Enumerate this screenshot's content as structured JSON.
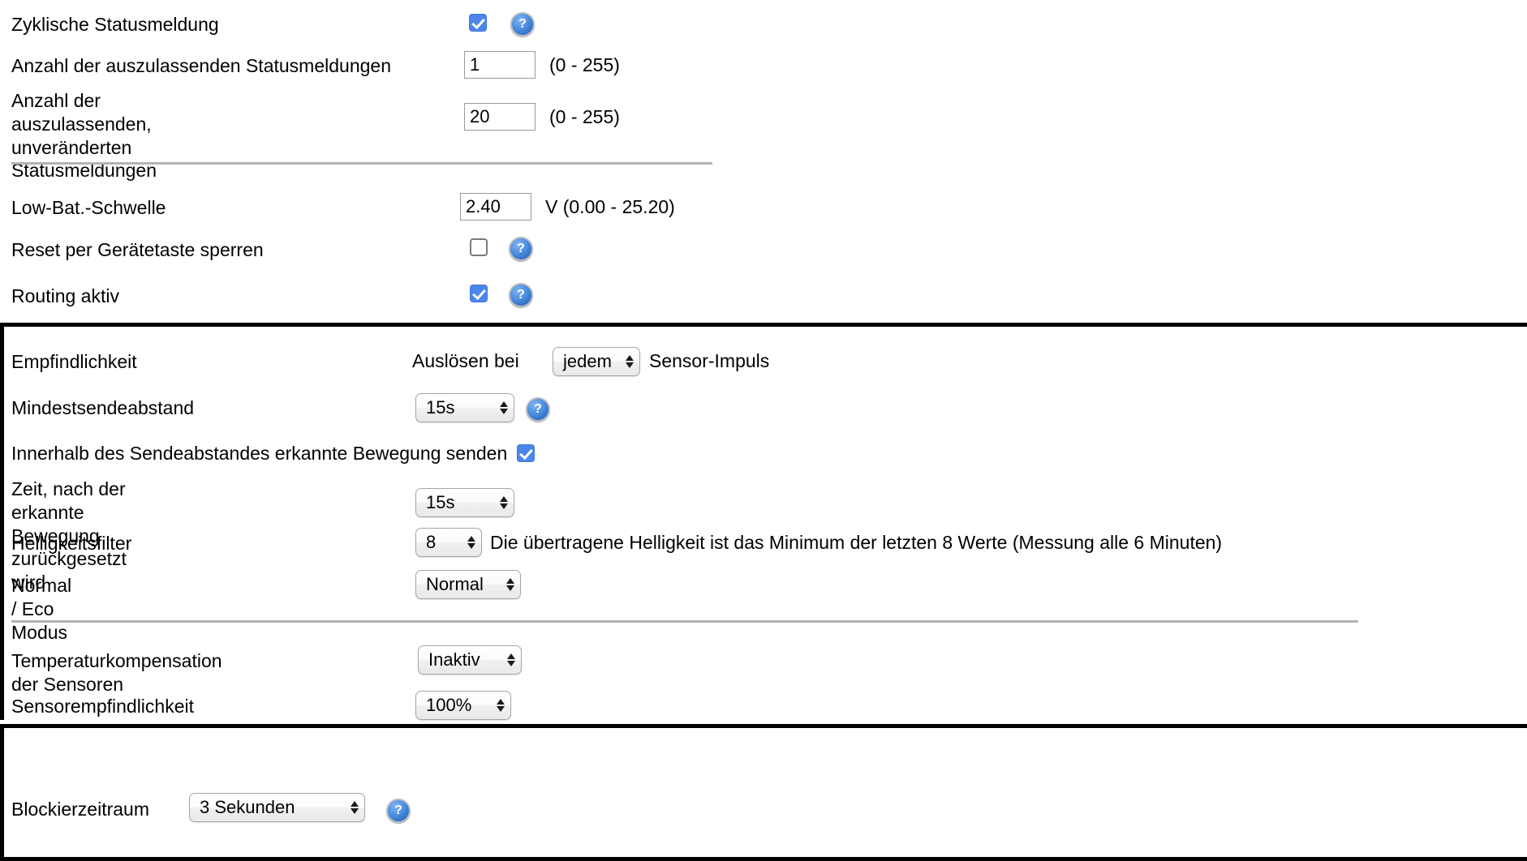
{
  "sections": {
    "status": {
      "cyclic_status": {
        "label": "Zyklische Statusmeldung",
        "checked_value": "on",
        "help": "?"
      },
      "skip_count": {
        "label": "Anzahl der auszulassenden Statusmeldungen",
        "value": "1",
        "range": "(0 - 255)"
      },
      "skip_unchanged_count": {
        "label": "Anzahl der auszulassenden,\nunveränderten Statusmeldungen",
        "value": "20",
        "range": "(0 - 255)"
      }
    },
    "device": {
      "low_bat": {
        "label": "Low-Bat.-Schwelle",
        "value": "2.40",
        "unit_range": "V (0.00 - 25.20)"
      },
      "lock_reset": {
        "label": "Reset per Gerätetaste sperren",
        "checked_value": "off",
        "help": "?"
      },
      "routing": {
        "label": "Routing aktiv",
        "checked_value": "on",
        "help": "?"
      }
    },
    "sensor": {
      "sensitivity": {
        "label": "Empfindlichkeit",
        "prefix": "Auslösen bei",
        "value": "jedem",
        "suffix": "Sensor-Impuls"
      },
      "min_send_interval": {
        "label": "Mindestsendeabstand",
        "value": "15s",
        "help": "?"
      },
      "send_within_interval": {
        "label": "Innerhalb des Sendeabstandes erkannte Bewegung senden",
        "checked_value": "on"
      },
      "motion_reset_time": {
        "label": "Zeit, nach der erkannte Bewegung\nzurückgesetzt wird",
        "value": "15s"
      },
      "brightness_filter": {
        "label": "Helligkeitsfilter",
        "value": "8",
        "description": "Die übertragene Helligkeit ist das Minimum der letzten 8 Werte (Messung alle 6 Minuten)"
      },
      "eco_mode": {
        "label": "Normal / Eco Modus",
        "value": "Normal"
      },
      "temp_compensation": {
        "label": "Temperaturkompensation der Sensoren",
        "value": "Inaktiv"
      },
      "sensor_sensitivity": {
        "label": "Sensorempfindlichkeit",
        "value": "100%"
      }
    },
    "blocking": {
      "blocking_period": {
        "label": "Blockierzeitraum",
        "value": "3 Sekunden",
        "help": "?"
      }
    }
  }
}
